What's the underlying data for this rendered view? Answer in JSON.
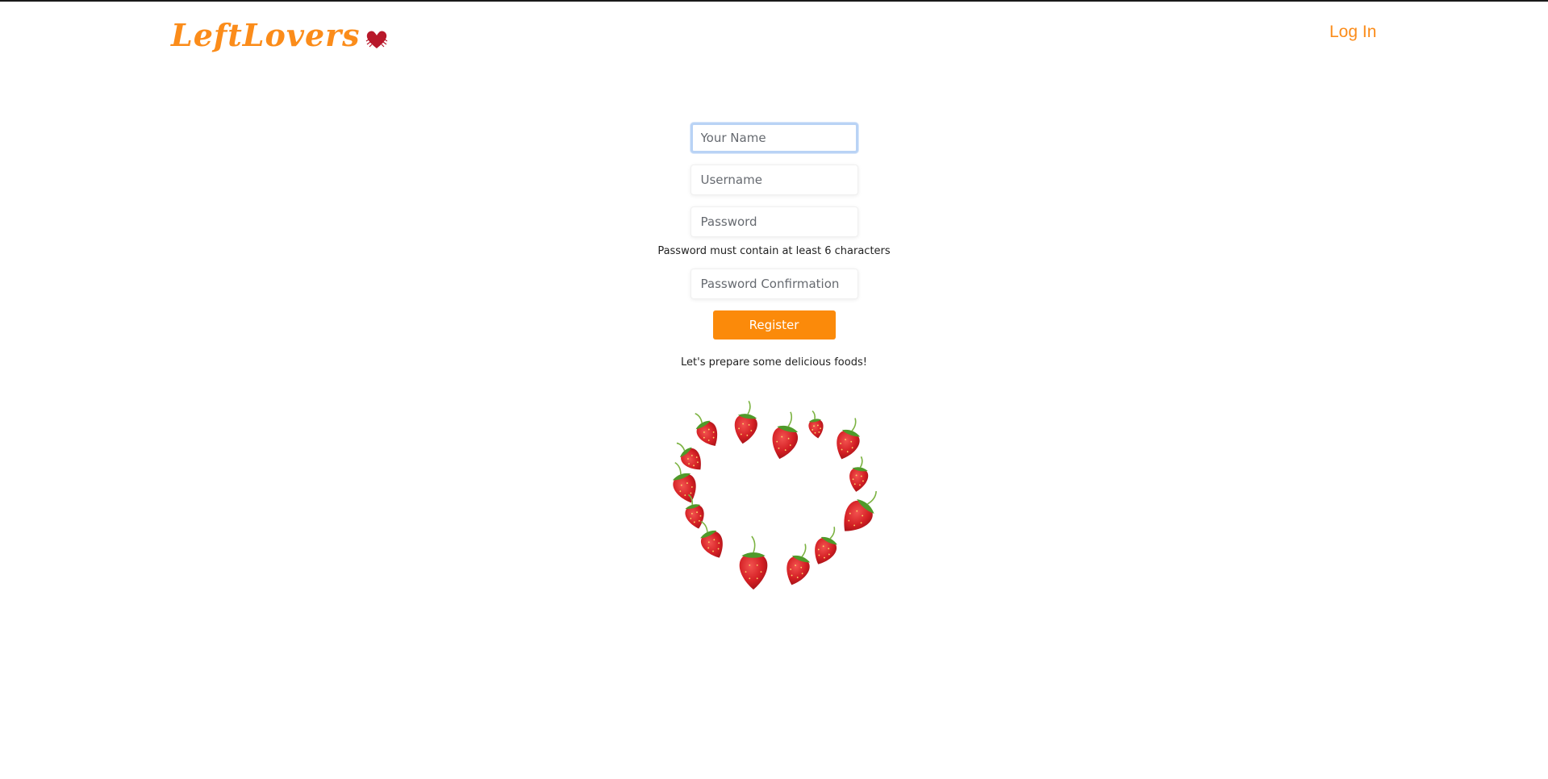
{
  "brand": {
    "name": "LeftLovers",
    "accent_color": "#fb8c1a",
    "heart_icon": "heart-icon"
  },
  "nav": {
    "login_label": "Log In"
  },
  "form": {
    "name_placeholder": "Your Name",
    "username_placeholder": "Username",
    "password_placeholder": "Password",
    "password_hint": "Password must contain at least 6 characters",
    "password_confirmation_placeholder": "Password Confirmation",
    "register_label": "Register",
    "button_color": "#fb8a0a"
  },
  "tagline": "Let's prepare some delicious foods!",
  "illustration": {
    "name": "strawberry-heart-illustration"
  }
}
